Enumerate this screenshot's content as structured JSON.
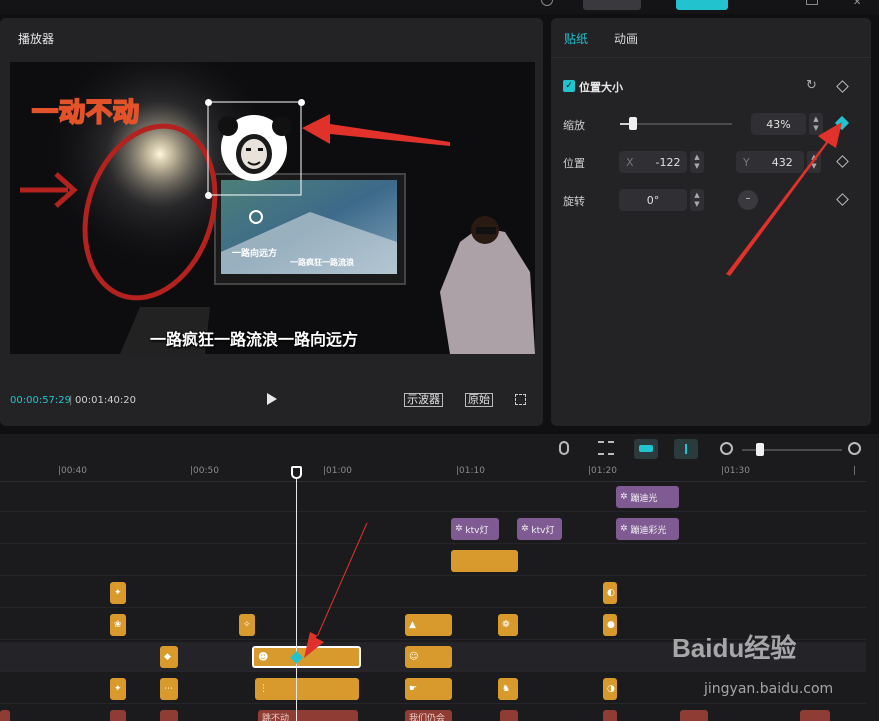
{
  "player": {
    "title": "播放器",
    "current_time": "00:00:57:29",
    "total_time": "00:01:40:20",
    "waveform_btn": "示波器",
    "original_btn": "原始",
    "overlay_text": "一动不动",
    "subtitle": "一路疯狂一路流浪一路向远方",
    "screen_text_1": "一路向远方",
    "screen_text_2": "一路疯狂一路流浪"
  },
  "props": {
    "tabs": [
      "贴纸",
      "动画"
    ],
    "active_tab": "贴纸",
    "section_title": "位置大小",
    "scale_label": "缩放",
    "scale_value": "43%",
    "scale_level": 0.43,
    "position_label": "位置",
    "x_axis": "X",
    "x_value": "-122",
    "y_axis": "Y",
    "y_value": "432",
    "rotate_label": "旋转",
    "rotate_value": "0°"
  },
  "timeline": {
    "ticks": [
      "00:40",
      "00:50",
      "01:00",
      "01:10",
      "01:20",
      "01:30"
    ],
    "fx_clips": [
      "蹦迪光",
      "ktv灯",
      "ktv灯",
      "蹦迪彩光"
    ],
    "bottom_clips": [
      "跳不动",
      "我们仍会"
    ]
  },
  "watermark": {
    "brand": "Baidu经验",
    "url": "jingyan.baidu.com"
  },
  "colors": {
    "accent": "#22c3cf",
    "clip": "#d89a2c",
    "effect": "#7f5a93",
    "arrow": "#e0322b"
  }
}
